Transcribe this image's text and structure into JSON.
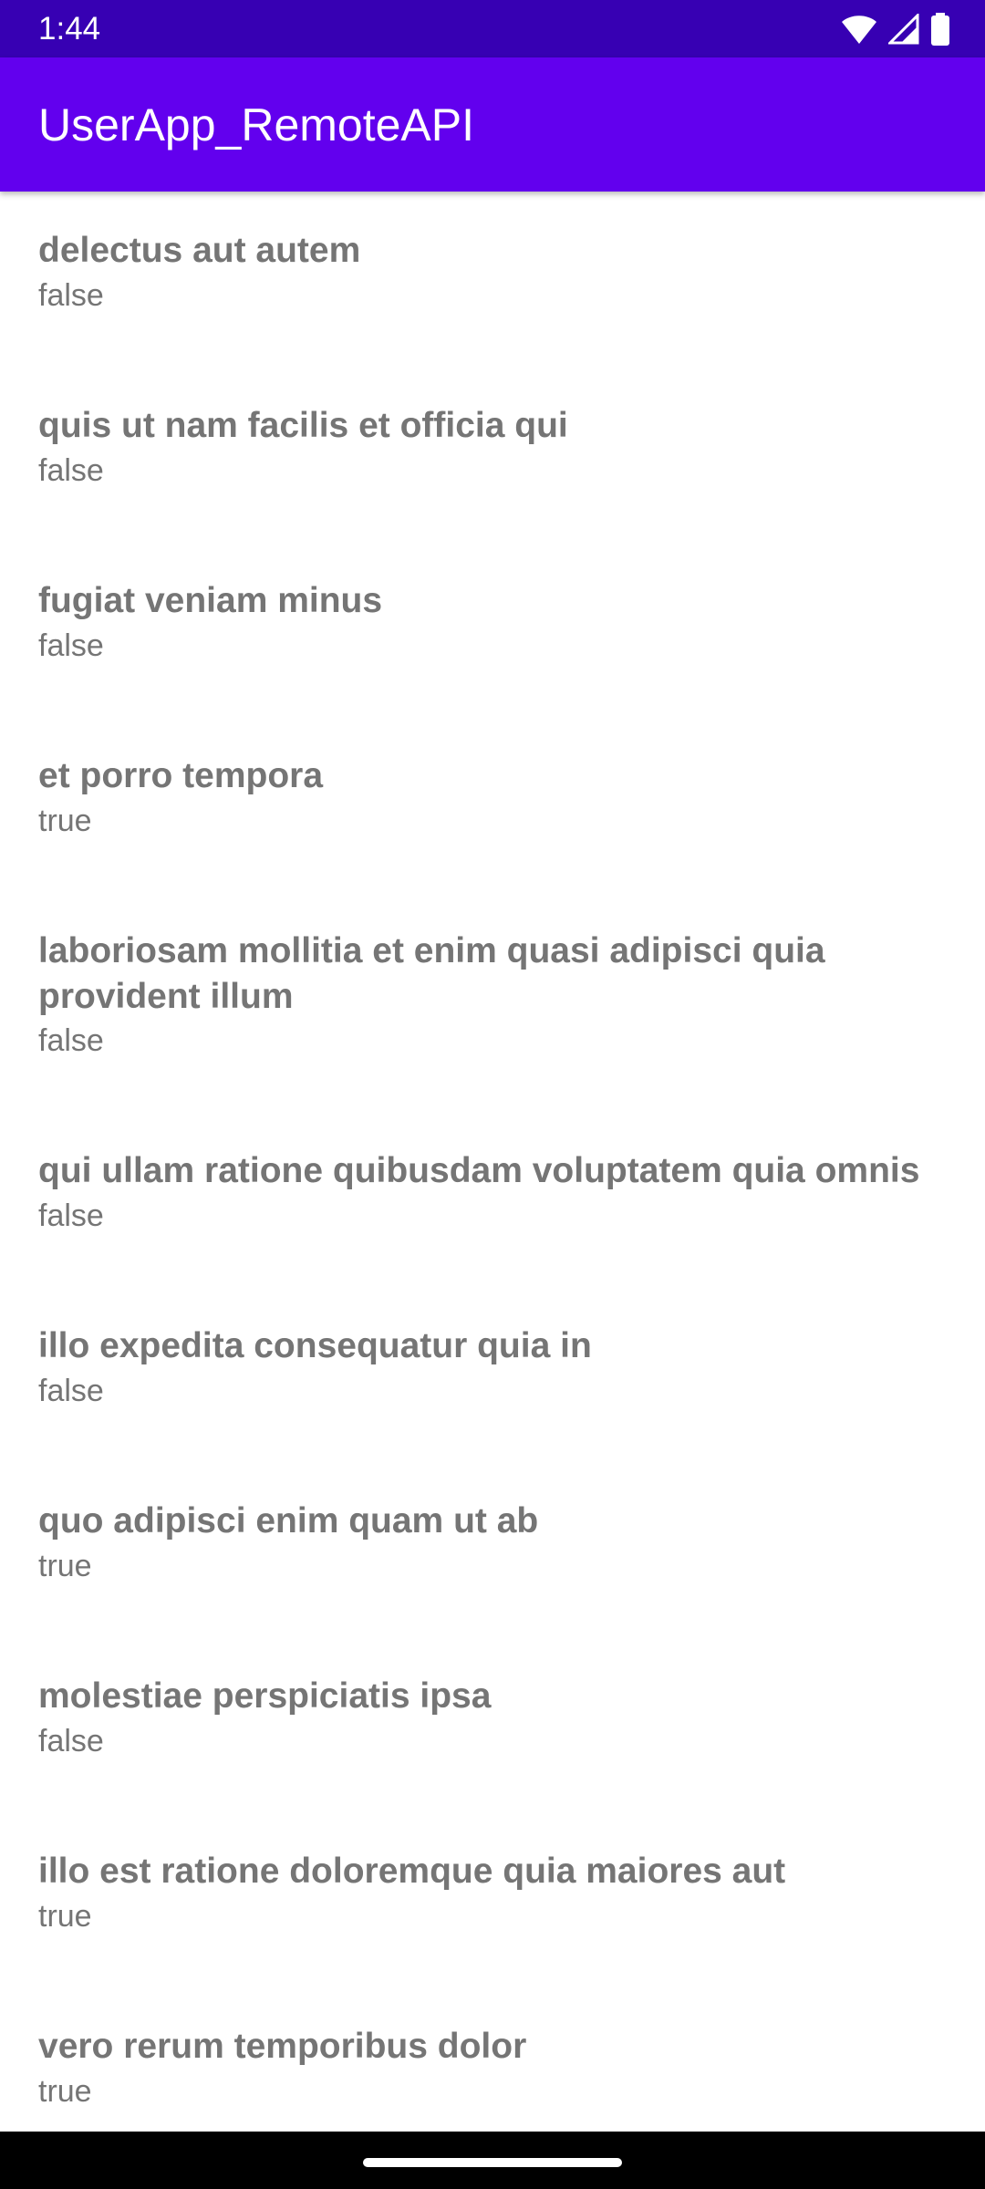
{
  "status_bar": {
    "time": "1:44",
    "icons": [
      "wifi-icon",
      "signal-icon",
      "battery-icon"
    ]
  },
  "app_bar": {
    "title": "UserApp_RemoteAPI",
    "color": "#6200ee",
    "status_color": "#3700b3"
  },
  "todos": [
    {
      "title": "delectus aut autem",
      "completed": "false"
    },
    {
      "title": "quis ut nam facilis et officia qui",
      "completed": "false"
    },
    {
      "title": "fugiat veniam minus",
      "completed": "false"
    },
    {
      "title": "et porro tempora",
      "completed": "true"
    },
    {
      "title": "laboriosam mollitia et enim quasi adipisci quia provident illum",
      "completed": "false"
    },
    {
      "title": "qui ullam ratione quibusdam voluptatem quia omnis",
      "completed": "false"
    },
    {
      "title": "illo expedita consequatur quia in",
      "completed": "false"
    },
    {
      "title": "quo adipisci enim quam ut ab",
      "completed": "true"
    },
    {
      "title": "molestiae perspiciatis ipsa",
      "completed": "false"
    },
    {
      "title": "illo est ratione doloremque quia maiores aut",
      "completed": "true"
    },
    {
      "title": "vero rerum temporibus dolor",
      "completed": "true"
    }
  ]
}
